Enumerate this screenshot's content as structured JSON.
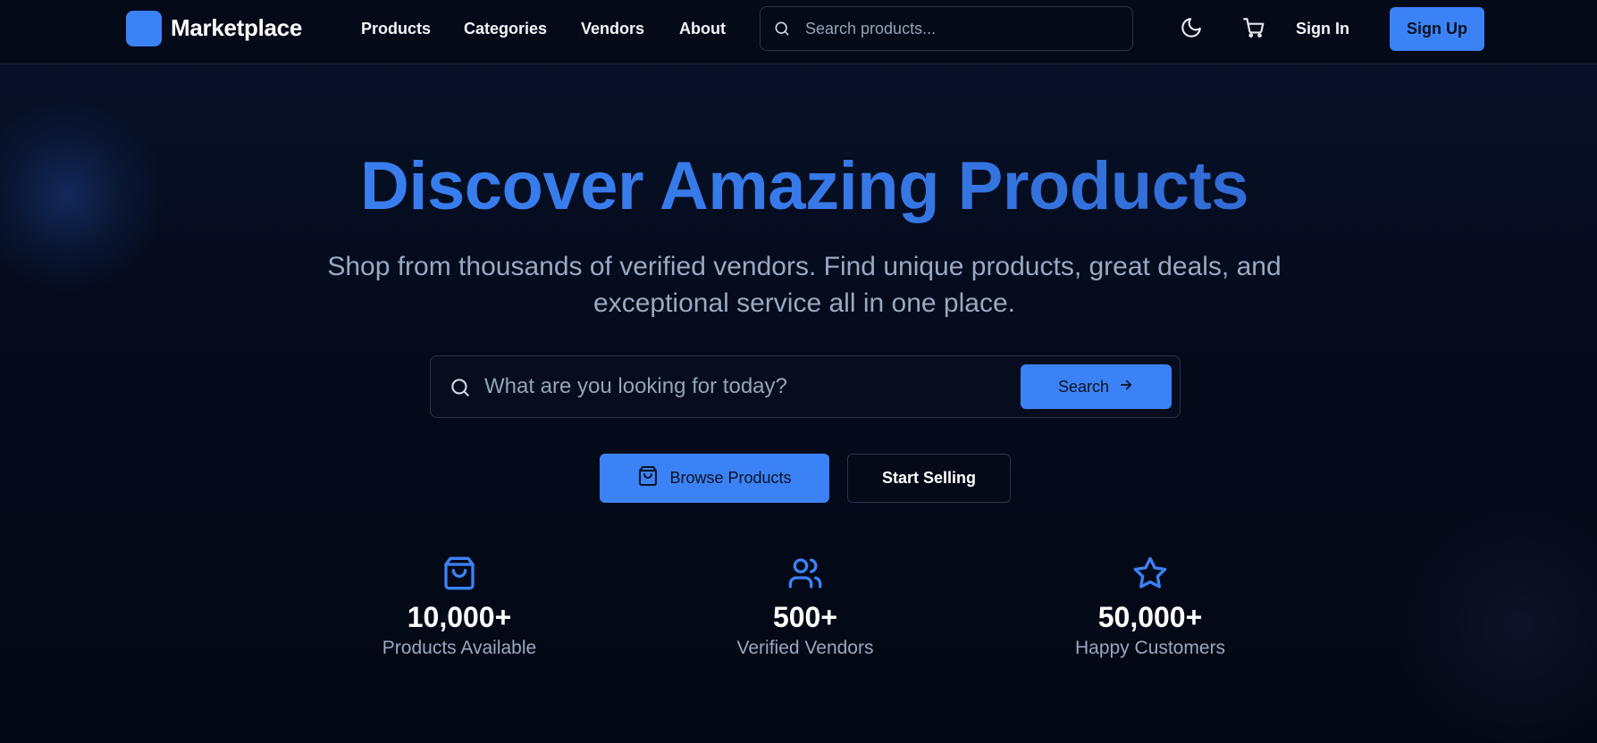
{
  "header": {
    "logo_text": "Marketplace",
    "nav": [
      "Products",
      "Categories",
      "Vendors",
      "About"
    ],
    "search_placeholder": "Search products...",
    "sign_in": "Sign In",
    "sign_up": "Sign Up"
  },
  "hero": {
    "title": "Discover Amazing Products",
    "subtitle": "Shop from thousands of verified vendors. Find unique products, great deals, and exceptional service all in one place.",
    "search_placeholder": "What are you looking for today?",
    "search_button": "Search",
    "browse_button": "Browse Products",
    "sell_button": "Start Selling"
  },
  "stats": [
    {
      "icon": "shopping-bag-icon",
      "value": "10,000+",
      "label": "Products Available"
    },
    {
      "icon": "users-icon",
      "value": "500+",
      "label": "Verified Vendors"
    },
    {
      "icon": "star-icon",
      "value": "50,000+",
      "label": "Happy Customers"
    }
  ],
  "colors": {
    "accent": "#3b82f6",
    "background": "#050a18",
    "muted_text": "#9aa8c0"
  }
}
